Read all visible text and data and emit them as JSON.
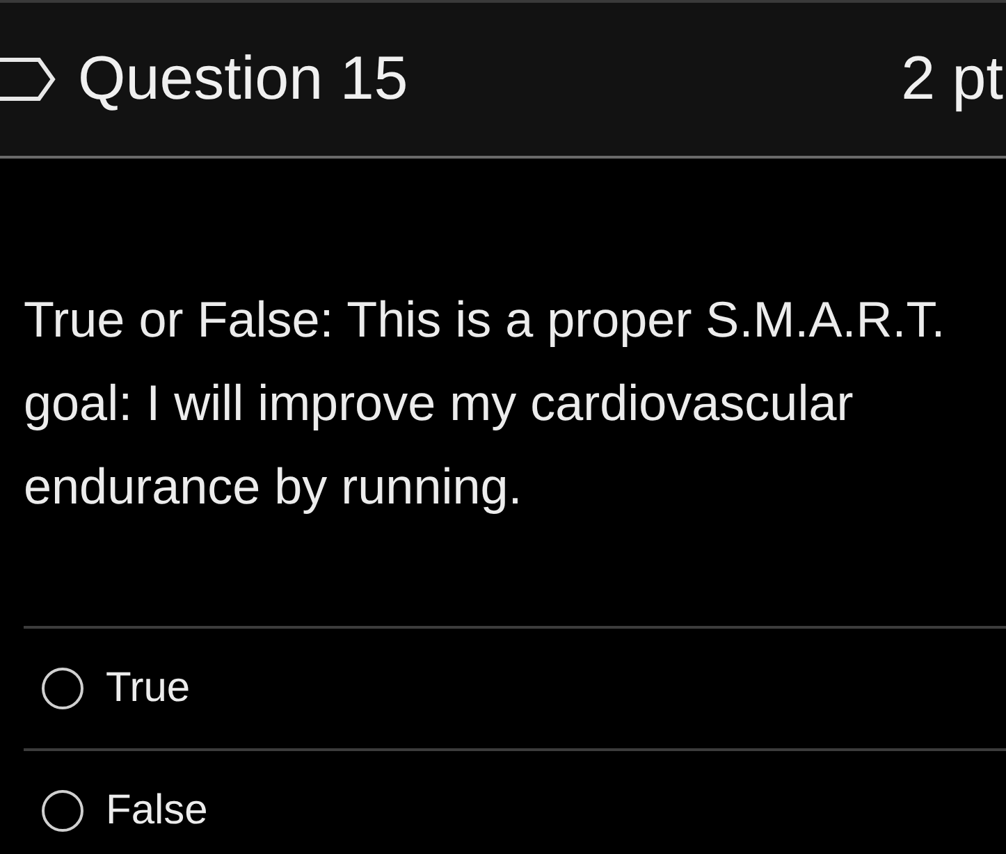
{
  "question": {
    "title": "Question 15",
    "points": "2 pt",
    "flagged": false,
    "text": "True or False: This is a proper S.M.A.R.T. goal: I will improve my cardiovascular endurance by running."
  },
  "answers": [
    {
      "label": "True",
      "selected": false
    },
    {
      "label": "False",
      "selected": false
    }
  ]
}
